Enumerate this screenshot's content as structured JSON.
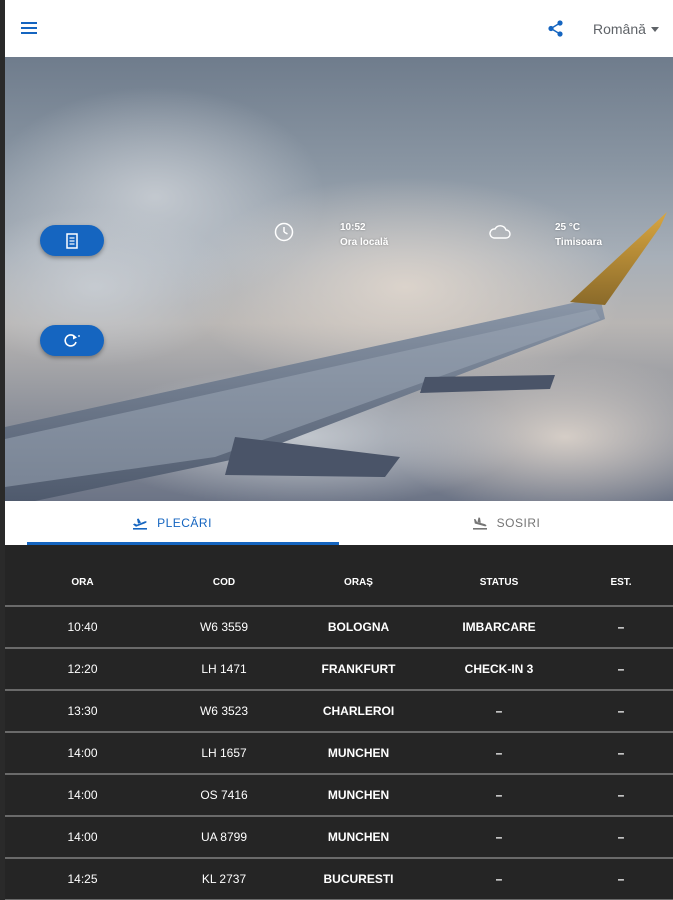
{
  "header": {
    "menu_icon": "hamburger-menu-icon",
    "share_icon": "share-icon",
    "language": "Română"
  },
  "hero": {
    "time": "10:52",
    "time_label": "Ora locală",
    "temperature": "25 °C",
    "city": "Timisoara",
    "print_icon": "receipt-icon",
    "refresh_icon": "refresh-icon",
    "clock_icon": "clock-icon",
    "weather_icon": "cloud-icon"
  },
  "tabs": [
    {
      "label": "PLECĂRI",
      "icon": "departure-plane-icon",
      "active": true
    },
    {
      "label": "SOSIRI",
      "icon": "arrival-plane-icon",
      "active": false
    }
  ],
  "table": {
    "headers": [
      "ORA",
      "COD",
      "ORAȘ",
      "STATUS",
      "EST."
    ],
    "rows": [
      [
        "10:40",
        "W6 3559",
        "BOLOGNA",
        "IMBARCARE",
        "–"
      ],
      [
        "12:20",
        "LH 1471",
        "FRANKFURT",
        "CHECK-IN 3",
        "–"
      ],
      [
        "13:30",
        "W6 3523",
        "CHARLEROI",
        "–",
        "–"
      ],
      [
        "14:00",
        "LH 1657",
        "MUNCHEN",
        "–",
        "–"
      ],
      [
        "14:00",
        "OS 7416",
        "MUNCHEN",
        "–",
        "–"
      ],
      [
        "14:00",
        "UA 8799",
        "MUNCHEN",
        "–",
        "–"
      ],
      [
        "14:25",
        "KL 2737",
        "BUCURESTI",
        "–",
        "–"
      ]
    ]
  },
  "colors": {
    "accent": "#1565c0",
    "table_bg": "#252525"
  }
}
